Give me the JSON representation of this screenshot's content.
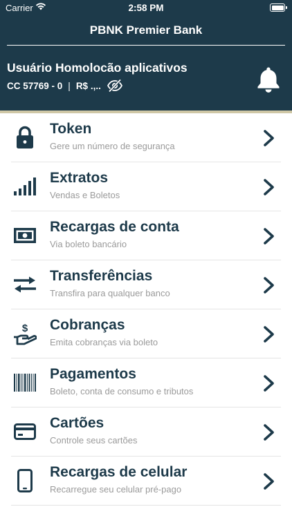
{
  "status_bar": {
    "carrier": "Carrier",
    "time": "2:58 PM",
    "battery": "full"
  },
  "header": {
    "bank_title": "PBNK Premier Bank",
    "user_name": "Usuário Homolocão aplicativos",
    "account": "CC 57769 - 0",
    "separator": "|",
    "balance": "R$ .,..",
    "notification_icon": "bell-icon",
    "visibility_icon": "eye-off-icon"
  },
  "colors": {
    "header_bg": "#1d3a4a",
    "accent_line": "#cfc7a6",
    "title": "#1d3a4a",
    "subtitle": "#9a9a9a"
  },
  "menu": {
    "items": [
      {
        "title": "Token",
        "subtitle": "Gere um número de segurança",
        "icon": "lock-icon"
      },
      {
        "title": "Extratos",
        "subtitle": "Vendas e Boletos",
        "icon": "signal-bars-icon"
      },
      {
        "title": "Recargas de conta",
        "subtitle": "Via boleto bancário",
        "icon": "money-bill-icon"
      },
      {
        "title": "Transferências",
        "subtitle": "Transfira para qualquer banco",
        "icon": "exchange-arrows-icon"
      },
      {
        "title": "Cobranças",
        "subtitle": "Emita cobranças via boleto",
        "icon": "hand-dollar-icon"
      },
      {
        "title": "Pagamentos",
        "subtitle": "Boleto, conta de consumo e tributos",
        "icon": "barcode-icon"
      },
      {
        "title": "Cartões",
        "subtitle": "Controle seus cartões",
        "icon": "credit-card-icon"
      },
      {
        "title": "Recargas de celular",
        "subtitle": "Recarregue seu celular pré-pago",
        "icon": "smartphone-icon"
      }
    ]
  }
}
